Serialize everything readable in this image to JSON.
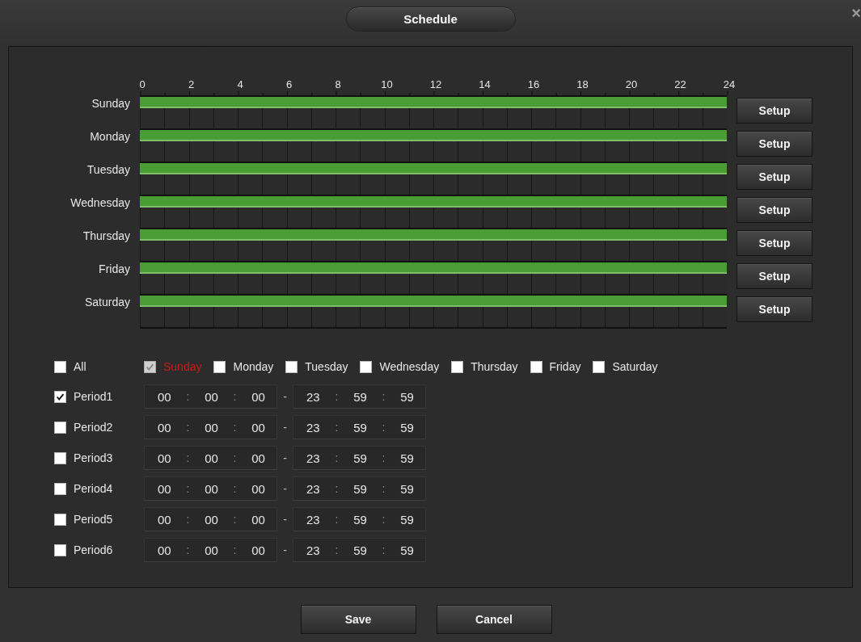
{
  "window": {
    "title": "Schedule",
    "close": "×"
  },
  "axis_labels": [
    "0",
    "2",
    "4",
    "6",
    "8",
    "10",
    "12",
    "14",
    "16",
    "18",
    "20",
    "22",
    "24"
  ],
  "days": [
    {
      "name": "Sunday",
      "level": 1,
      "button": "Setup"
    },
    {
      "name": "Monday",
      "level": 1,
      "button": "Setup"
    },
    {
      "name": "Tuesday",
      "level": 1,
      "button": "Setup"
    },
    {
      "name": "Wednesday",
      "level": 1,
      "button": "Setup"
    },
    {
      "name": "Thursday",
      "level": 1,
      "button": "Setup"
    },
    {
      "name": "Friday",
      "level": 1,
      "button": "Setup"
    },
    {
      "name": "Saturday",
      "level": 1,
      "button": "Setup"
    }
  ],
  "all": {
    "label": "All",
    "checked": false
  },
  "day_checks": [
    {
      "label": "Sunday",
      "checked": true,
      "current": true
    },
    {
      "label": "Monday",
      "checked": false,
      "current": false
    },
    {
      "label": "Tuesday",
      "checked": false,
      "current": false
    },
    {
      "label": "Wednesday",
      "checked": false,
      "current": false
    },
    {
      "label": "Thursday",
      "checked": false,
      "current": false
    },
    {
      "label": "Friday",
      "checked": false,
      "current": false
    },
    {
      "label": "Saturday",
      "checked": false,
      "current": false
    }
  ],
  "periods": [
    {
      "label": "Period1",
      "checked": true,
      "start": [
        "00",
        ":",
        "00",
        ":",
        "00"
      ],
      "dash": "-",
      "end": [
        "23",
        ":",
        "59",
        ":",
        "59"
      ]
    },
    {
      "label": "Period2",
      "checked": false,
      "start": [
        "00",
        ":",
        "00",
        ":",
        "00"
      ],
      "dash": "-",
      "end": [
        "23",
        ":",
        "59",
        ":",
        "59"
      ]
    },
    {
      "label": "Period3",
      "checked": false,
      "start": [
        "00",
        ":",
        "00",
        ":",
        "00"
      ],
      "dash": "-",
      "end": [
        "23",
        ":",
        "59",
        ":",
        "59"
      ]
    },
    {
      "label": "Period4",
      "checked": false,
      "start": [
        "00",
        ":",
        "00",
        ":",
        "00"
      ],
      "dash": "-",
      "end": [
        "23",
        ":",
        "59",
        ":",
        "59"
      ]
    },
    {
      "label": "Period5",
      "checked": false,
      "start": [
        "00",
        ":",
        "00",
        ":",
        "00"
      ],
      "dash": "-",
      "end": [
        "23",
        ":",
        "59",
        ":",
        "59"
      ]
    },
    {
      "label": "Period6",
      "checked": false,
      "start": [
        "00",
        ":",
        "00",
        ":",
        "00"
      ],
      "dash": "-",
      "end": [
        "23",
        ":",
        "59",
        ":",
        "59"
      ]
    }
  ],
  "buttons": [
    "Save",
    "Cancel"
  ]
}
